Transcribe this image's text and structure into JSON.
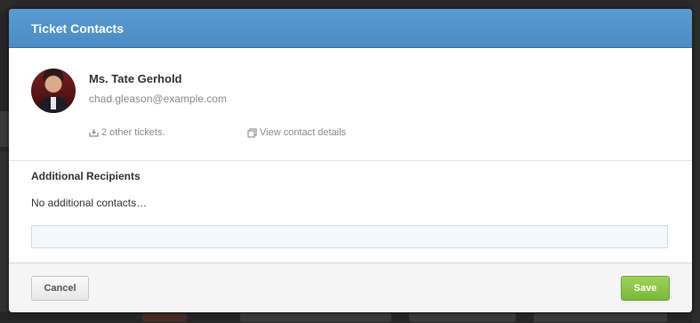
{
  "modal": {
    "title": "Ticket Contacts"
  },
  "contact": {
    "name": "Ms. Tate Gerhold",
    "email": "chad.gleason@example.com",
    "tickets_link": "2 other tickets.",
    "details_link": "View contact details"
  },
  "recipients": {
    "heading": "Additional Recipients",
    "empty_text": "No additional contacts…",
    "input_value": "",
    "input_placeholder": ""
  },
  "footer": {
    "cancel_label": "Cancel",
    "save_label": "Save"
  },
  "colors": {
    "header": "#4a8cc4",
    "save": "#86c447",
    "overlay": "#262626"
  },
  "icons": {
    "tickets": "inbox-icon",
    "details": "copy-icon"
  }
}
